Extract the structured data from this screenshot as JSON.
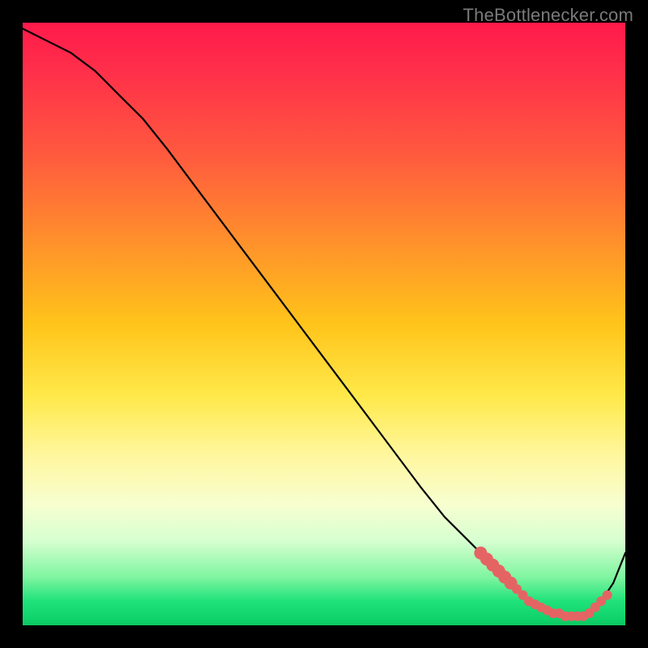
{
  "attribution": "TheBottlenecker.com",
  "colors": {
    "frame": "#000000",
    "curve": "#000000",
    "marker": "#e46464",
    "attribution_text": "#7a7a7a"
  },
  "chart_data": {
    "type": "line",
    "title": "",
    "xlabel": "",
    "ylabel": "",
    "xlim": [
      0,
      100
    ],
    "ylim": [
      0,
      100
    ],
    "grid": false,
    "series": [
      {
        "name": "bottleneck-curve",
        "x": [
          0,
          4,
          8,
          12,
          16,
          20,
          24,
          30,
          36,
          42,
          48,
          54,
          60,
          66,
          70,
          74,
          78,
          80,
          82,
          84,
          86,
          88,
          90,
          92,
          94,
          96,
          98,
          100
        ],
        "values": [
          99,
          97,
          95,
          92,
          88,
          84,
          79,
          71,
          63,
          55,
          47,
          39,
          31,
          23,
          18,
          14,
          10,
          8,
          6,
          4,
          3,
          2,
          1.5,
          1.5,
          2,
          4,
          7,
          12
        ]
      }
    ],
    "markers": [
      {
        "name": "highlight-cluster",
        "x": [
          76,
          77,
          78,
          79,
          80,
          81,
          82,
          83,
          84,
          85,
          86,
          87,
          88,
          89,
          90,
          91,
          92,
          93,
          94,
          95,
          96,
          97
        ],
        "values": [
          12,
          11,
          10,
          9,
          8,
          7,
          6,
          5,
          4,
          3.5,
          3,
          2.5,
          2,
          2,
          1.5,
          1.5,
          1.5,
          1.5,
          2,
          3,
          4,
          5
        ]
      }
    ]
  }
}
